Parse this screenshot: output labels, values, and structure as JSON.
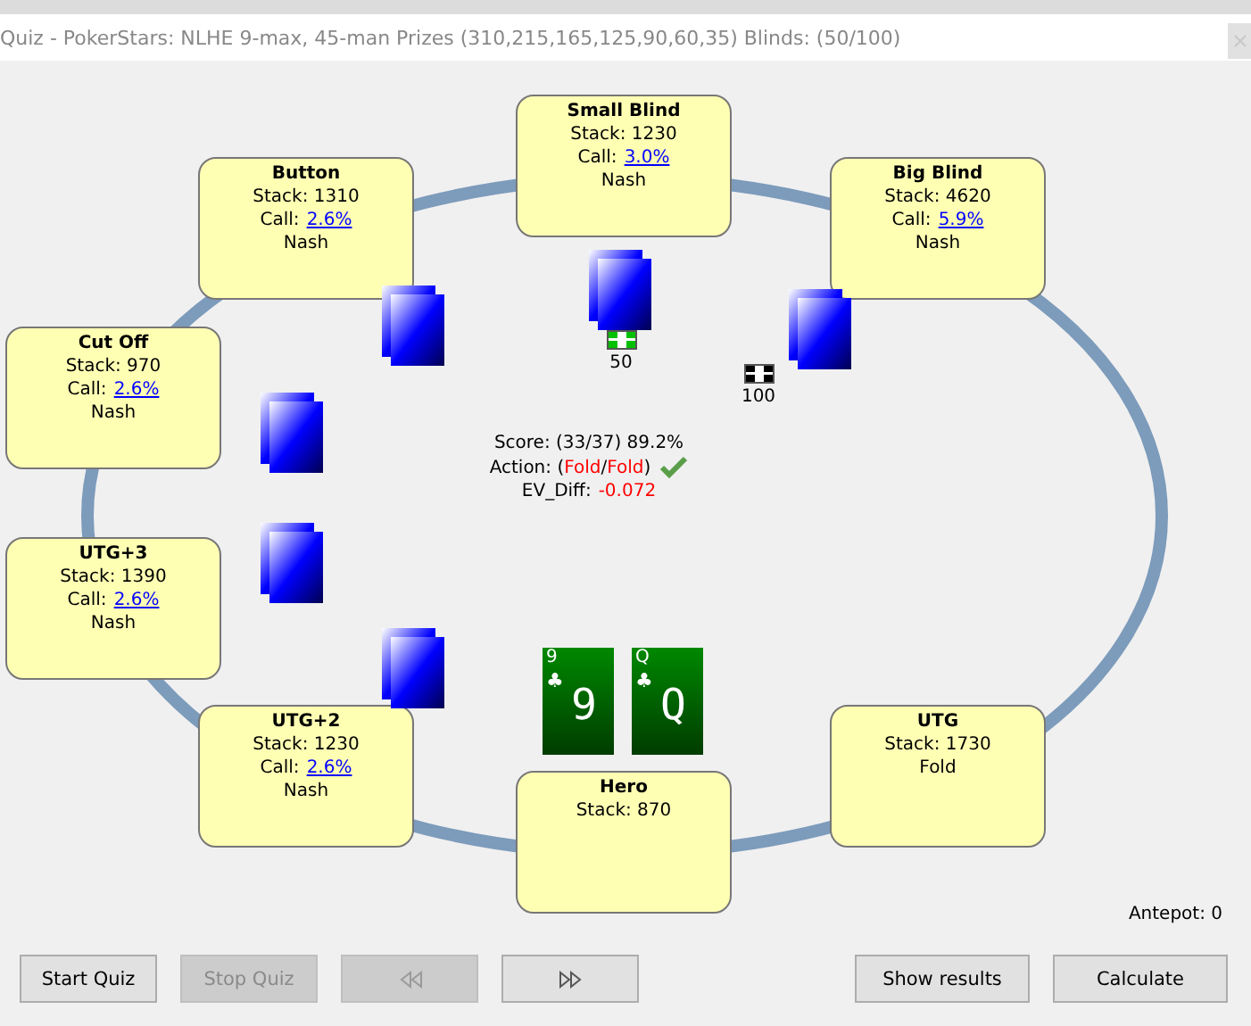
{
  "window": {
    "title": "Quiz - PokerStars: NLHE 9-max, 45-man Prizes (310,215,165,125,90,60,35) Blinds: (50/100)"
  },
  "seats": [
    {
      "name": "Small Blind",
      "stack": "Stack: 1230",
      "call_label": "Call:",
      "call": "3.0%",
      "action": "Nash",
      "card_backs": true,
      "bet": {
        "amount": "50",
        "color": "#00c000"
      }
    },
    {
      "name": "Button",
      "stack": "Stack: 1310",
      "call_label": "Call:",
      "call": "2.6%",
      "action": "Nash",
      "card_backs": true
    },
    {
      "name": "Big Blind",
      "stack": "Stack: 4620",
      "call_label": "Call:",
      "call": "5.9%",
      "action": "Nash",
      "card_backs": true,
      "bet": {
        "amount": "100",
        "color": "#000000"
      }
    },
    {
      "name": "Cut Off",
      "stack": "Stack: 970",
      "call_label": "Call:",
      "call": "2.6%",
      "action": "Nash",
      "card_backs": true
    },
    {
      "name": "UTG+3",
      "stack": "Stack: 1390",
      "call_label": "Call:",
      "call": "2.6%",
      "action": "Nash",
      "card_backs": true
    },
    {
      "name": "UTG+2",
      "stack": "Stack: 1230",
      "call_label": "Call:",
      "call": "2.6%",
      "action": "Nash",
      "card_backs": true
    },
    {
      "name": "Hero",
      "stack": "Stack: 870",
      "card_backs": false
    },
    {
      "name": "UTG",
      "stack": "Stack: 1730",
      "action": "Fold",
      "card_backs": false
    }
  ],
  "hero_cards": [
    {
      "corner": "9",
      "suit": "♣",
      "rank": "9"
    },
    {
      "corner": "Q",
      "suit": "♣",
      "rank": "Q"
    }
  ],
  "score": "Score: (33/37) 89.2%",
  "action_parts": [
    {
      "text": "Action: (",
      "kind": "plain"
    },
    {
      "text": "Fold",
      "kind": "highlight"
    },
    {
      "text": "/",
      "kind": "plain"
    },
    {
      "text": "Fold",
      "kind": "highlight"
    },
    {
      "text": ")",
      "kind": "plain"
    }
  ],
  "action_correct": true,
  "ev": {
    "label": "EV_Diff:",
    "value": "-0.072"
  },
  "antepot": "Antepot: 0",
  "left_buttons": [
    {
      "kind": "text",
      "label": "Start Quiz",
      "disabled": false
    },
    {
      "kind": "text",
      "label": "Stop Quiz",
      "disabled": true
    },
    {
      "kind": "rewind",
      "disabled": true
    },
    {
      "kind": "forward",
      "disabled": false
    }
  ],
  "right_buttons": [
    {
      "kind": "text",
      "label": "Show results",
      "disabled": false
    },
    {
      "kind": "text",
      "label": "Calculate",
      "disabled": false
    }
  ]
}
